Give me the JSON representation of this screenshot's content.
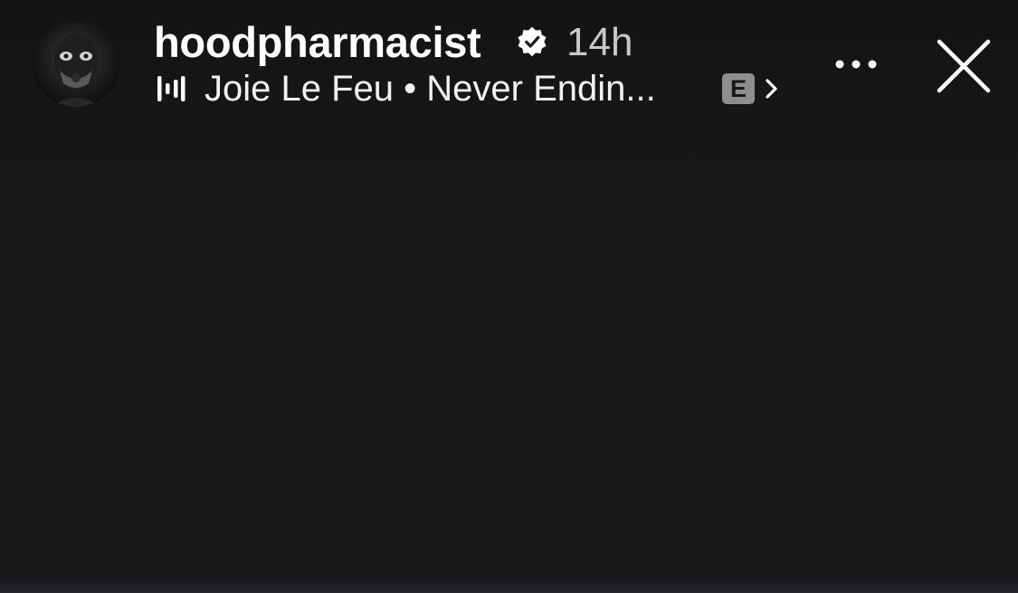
{
  "story": {
    "username": "hoodpharmacist",
    "verified": true,
    "timestamp": "14h",
    "music": {
      "artist": "Joie Le Feu",
      "separator": "•",
      "song": "Never Endin...",
      "line": "Joie Le Feu • Never Endin...",
      "explicit_badge": "E"
    }
  },
  "icons": {
    "avatar": "masked-figure-avatar",
    "verified": "verified-badge-icon",
    "music": "music-waveform-icon",
    "chevron": "chevron-right-icon",
    "more": "more-options-icon",
    "close": "close-icon"
  },
  "colors": {
    "background": "#18181b",
    "text_primary": "#ffffff",
    "text_secondary": "#c8c8c8",
    "explicit_badge_bg": "#8e8e8e"
  }
}
